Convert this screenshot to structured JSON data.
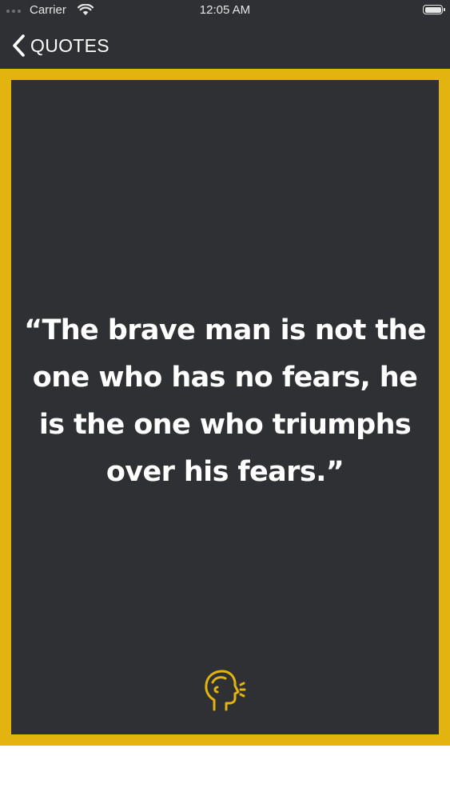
{
  "status_bar": {
    "carrier": "Carrier",
    "time": "12:05 AM"
  },
  "nav": {
    "back_label": "QUOTES"
  },
  "quote": {
    "text": "“The brave man is not the one who has no fears, he is the one who triumphs over his fears.”"
  },
  "colors": {
    "background": "#2e3033",
    "accent": "#e3b410",
    "text": "#ffffff"
  },
  "icons": {
    "back": "chevron-left-icon",
    "author": "speaking-head-icon"
  }
}
